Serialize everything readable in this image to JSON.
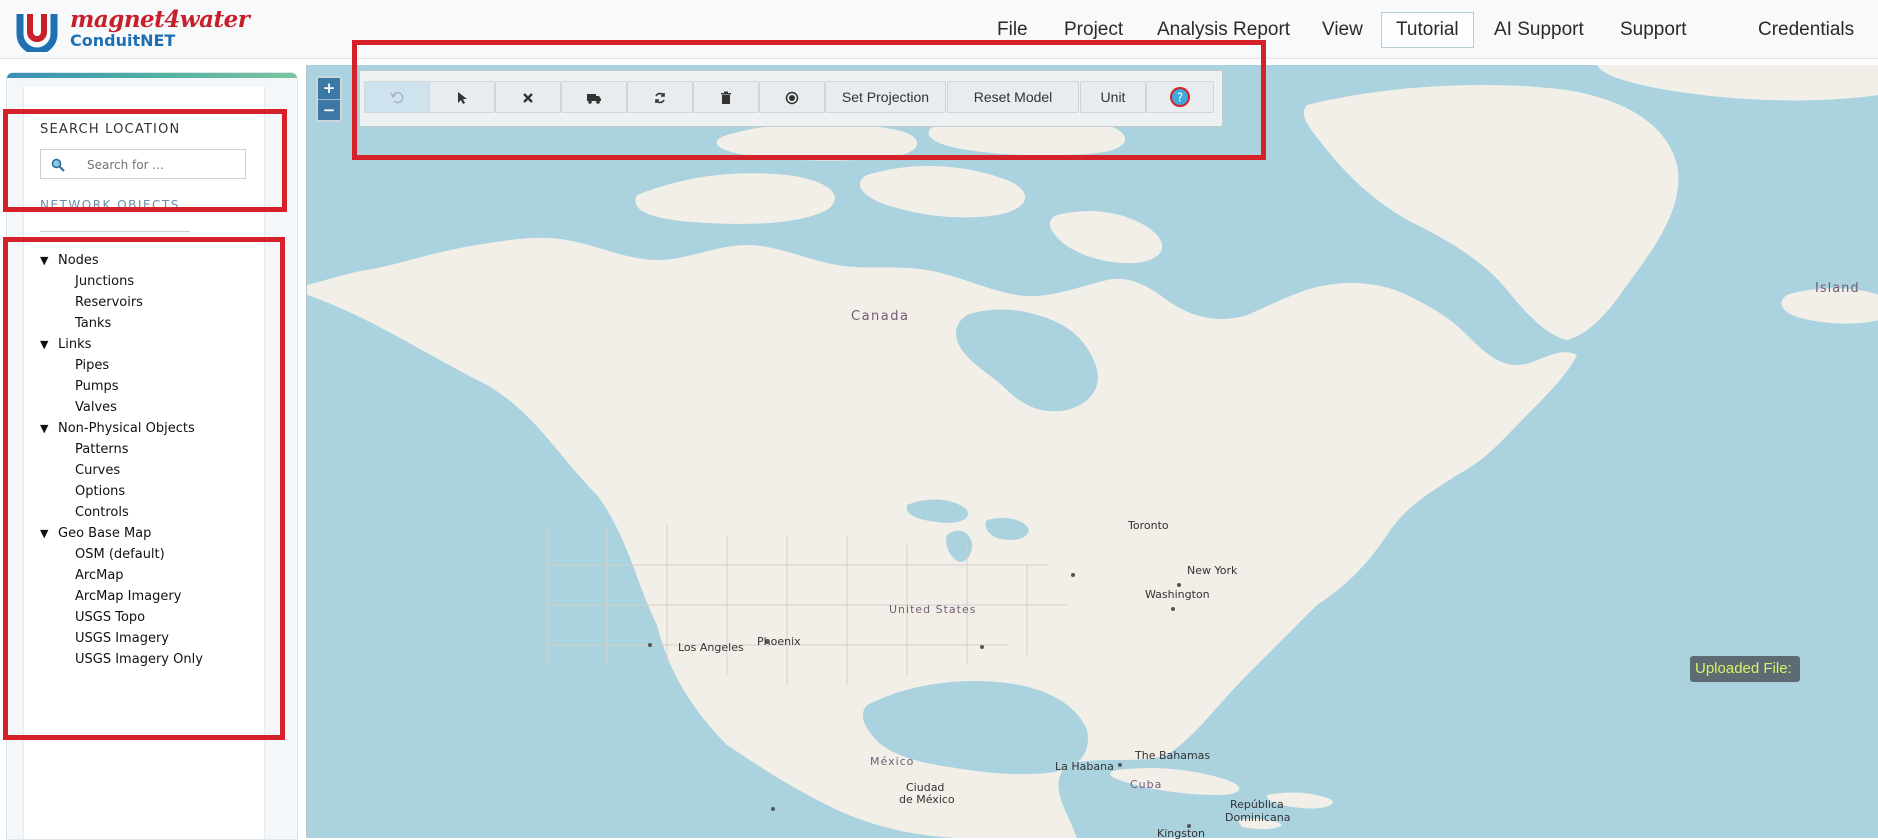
{
  "brand": {
    "top": "magnet4water",
    "bottom": "ConduitNET"
  },
  "nav": [
    {
      "label": "File"
    },
    {
      "label": "Project"
    },
    {
      "label": "Analysis Report"
    },
    {
      "label": "View"
    },
    {
      "label": "Tutorial"
    },
    {
      "label": "AI Support"
    },
    {
      "label": "Support"
    },
    {
      "label": "Credentials"
    }
  ],
  "sidebar": {
    "search_label": "SEARCH LOCATION",
    "search_placeholder": "Search for ...",
    "network_label": "NETWORK OBJECTS",
    "groups": [
      {
        "label": "Nodes",
        "items": [
          "Junctions",
          "Reservoirs",
          "Tanks"
        ]
      },
      {
        "label": "Links",
        "items": [
          "Pipes",
          "Pumps",
          "Valves"
        ]
      },
      {
        "label": "Non-Physical Objects",
        "items": [
          "Patterns",
          "Curves",
          "Options",
          "Controls"
        ]
      },
      {
        "label": "Geo Base Map",
        "items": [
          "OSM (default)",
          "ArcMap",
          "ArcMap Imagery",
          "USGS Topo",
          "USGS Imagery",
          "USGS Imagery Only"
        ]
      }
    ]
  },
  "zoom": {
    "in": "+",
    "out": "−"
  },
  "toolbar": {
    "icons": [
      "undo-icon",
      "pointer-icon",
      "delete-icon",
      "truck-icon",
      "refresh-icon",
      "trash-icon",
      "record-icon"
    ],
    "set_projection": "Set Projection",
    "reset_model": "Reset Model",
    "unit": "Unit",
    "help_icon": "help-icon"
  },
  "map_labels": {
    "canada": "Canada",
    "island": "Island",
    "toronto": "Toronto",
    "new_york": "New York",
    "washington": "Washington",
    "united_states": "United States",
    "phoenix": "Phoenix",
    "los_angeles": "Los Angeles",
    "mexico": "México",
    "ciudad": "Ciudad",
    "de_mexico": "de México",
    "la_habana": "La Habana",
    "bahamas": "The Bahamas",
    "cuba": "Cuba",
    "republica": "República",
    "dominicana": "Dominicana",
    "kingston": "Kingston"
  },
  "uploaded_file": "Uploaded File:",
  "colors": {
    "water": "#aad3df",
    "land": "#f2efe9",
    "accent": "#d6202a",
    "brand_red": "#c8202a",
    "brand_blue": "#1f6fb3"
  }
}
